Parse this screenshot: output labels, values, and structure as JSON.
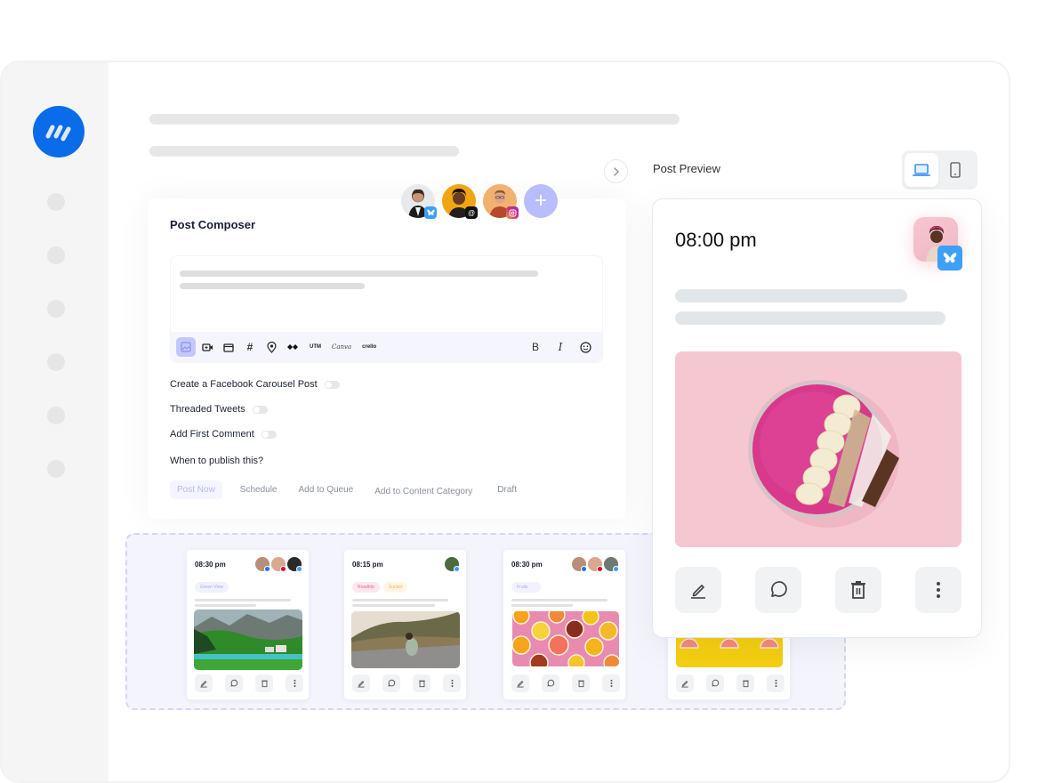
{
  "sidebar": {
    "logo": "brand-logo",
    "nav_items": [
      "nav-item-1",
      "nav-item-2",
      "nav-item-3",
      "nav-item-4",
      "nav-item-5",
      "nav-item-6"
    ]
  },
  "composer": {
    "title": "Post Composer",
    "accounts": [
      {
        "name": "account-1",
        "platform": "bluesky",
        "badge_color": "#3d9ff6"
      },
      {
        "name": "account-2",
        "platform": "threads",
        "badge_color": "#111111"
      },
      {
        "name": "account-3",
        "platform": "instagram",
        "badge_color": "#d6338a"
      }
    ],
    "add_account_label": "+",
    "toolbar": {
      "icons": [
        "image-icon",
        "video-icon",
        "folder-icon",
        "hashtag-icon",
        "location-icon",
        "link-shortener-icon"
      ],
      "utm_label": "UTM",
      "canva_label": "Canva",
      "crello_label": "crello",
      "bold_label": "B",
      "italic_label": "I",
      "emoji_icon": "emoji-icon"
    },
    "options": [
      {
        "label": "Create a Facebook Carousel Post",
        "enabled": false
      },
      {
        "label": "Threaded Tweets",
        "enabled": false
      },
      {
        "label": "Add First Comment",
        "enabled": false
      }
    ],
    "publish_question": "When to publish this?",
    "publish_tabs": [
      "Post Now",
      "Schedule",
      "Add to Queue",
      "Add to Content Category",
      "Draft"
    ],
    "publish_active": "Post Now"
  },
  "preview": {
    "title": "Post Preview",
    "device_modes": [
      "desktop",
      "mobile"
    ],
    "active_device": "desktop",
    "time": "08:00 pm",
    "platform": "bluesky",
    "image": "smoothie-bowl",
    "actions": [
      "edit",
      "comment",
      "delete",
      "more"
    ]
  },
  "queue": {
    "cards": [
      {
        "time": "08:30 pm",
        "tags": [
          {
            "label": "Green View",
            "bg": "#f1f1fd",
            "color": "#a7abe6"
          }
        ],
        "image": "mountain-valley",
        "platforms": [
          "facebook",
          "pinterest",
          "bluesky"
        ]
      },
      {
        "time": "08:15 pm",
        "tags": [
          {
            "label": "Roadtrip",
            "bg": "#fde8ef",
            "color": "#e36a93"
          },
          {
            "label": "Sunset",
            "bg": "#fff5e6",
            "color": "#f2b457"
          }
        ],
        "image": "road-sitting",
        "platforms": [
          "bluesky"
        ]
      },
      {
        "time": "08:30 pm",
        "tags": [
          {
            "label": "Fruits",
            "bg": "#f1f2fd",
            "color": "#a9aee6"
          }
        ],
        "image": "citrus-slices",
        "platforms": [
          "facebook",
          "pinterest",
          "bluesky"
        ]
      },
      {
        "time": "",
        "tags": [],
        "image": "grapefruit-yellow",
        "platforms": []
      }
    ]
  },
  "colors": {
    "brand": "#0a6ce8",
    "accent": "#b8bdfb",
    "bluesky": "#3d9ff6"
  }
}
